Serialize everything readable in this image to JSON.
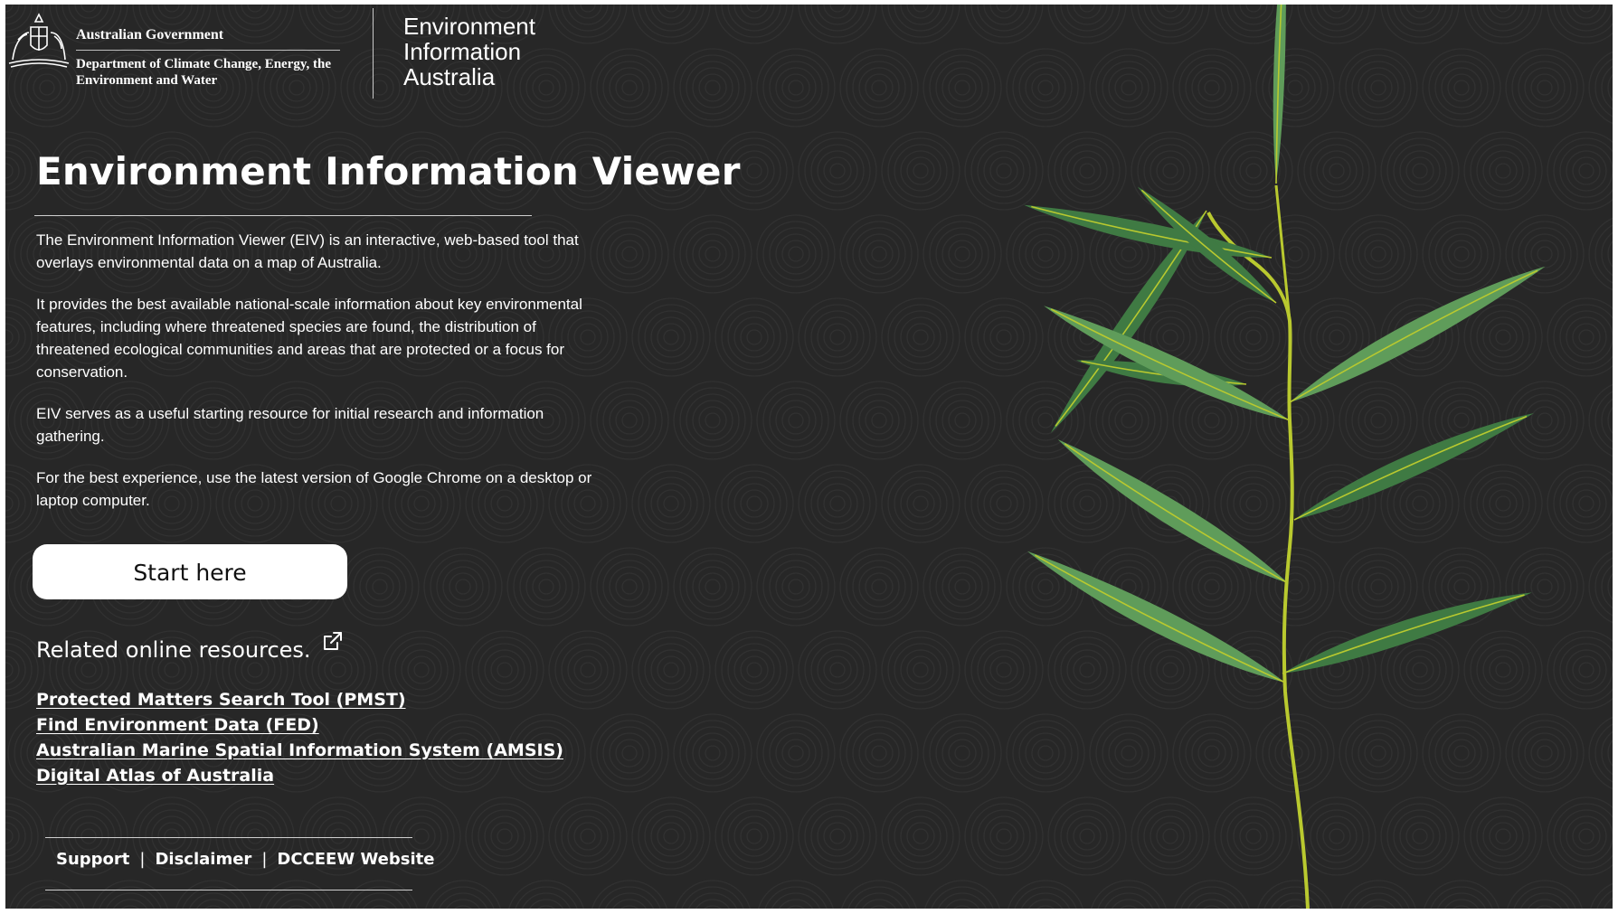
{
  "header": {
    "gov_name": "Australian Government",
    "department": "Department of Climate Change, Energy, the Environment and Water",
    "eia_logo_lines": [
      "Environment",
      "Information",
      "Australia"
    ]
  },
  "page": {
    "title": "Environment Information Viewer",
    "paragraphs": [
      "The Environment Information Viewer (EIV) is an interactive, web-based tool that overlays environmental data on a map of Australia.",
      "It provides the best available national-scale information about key environmental features, including where threatened species are found, the distribution of threatened ecological communities and areas that are protected or a focus for conservation.",
      "EIV serves as a useful starting resource for initial research and information gathering.",
      "For the best experience, use the latest version of Google Chrome on a desktop or laptop computer."
    ],
    "start_button": "Start here"
  },
  "related": {
    "heading": "Related online resources.",
    "icon": "external-link-icon",
    "links": [
      "Protected Matters Search Tool (PMST)",
      "Find Environment Data (FED)",
      "Australian Marine Spatial Information System (AMSIS)",
      "Digital Atlas of Australia"
    ]
  },
  "footer": {
    "links": [
      "Support",
      "Disclaimer",
      "DCCEEW Website"
    ],
    "separator": "|"
  },
  "colors": {
    "background": "#272727",
    "pattern": "#3a3a3a",
    "leaf_dark": "#3f7a43",
    "leaf_light": "#5f9c5a",
    "stem": "#b9c92f",
    "text": "#ffffff"
  }
}
